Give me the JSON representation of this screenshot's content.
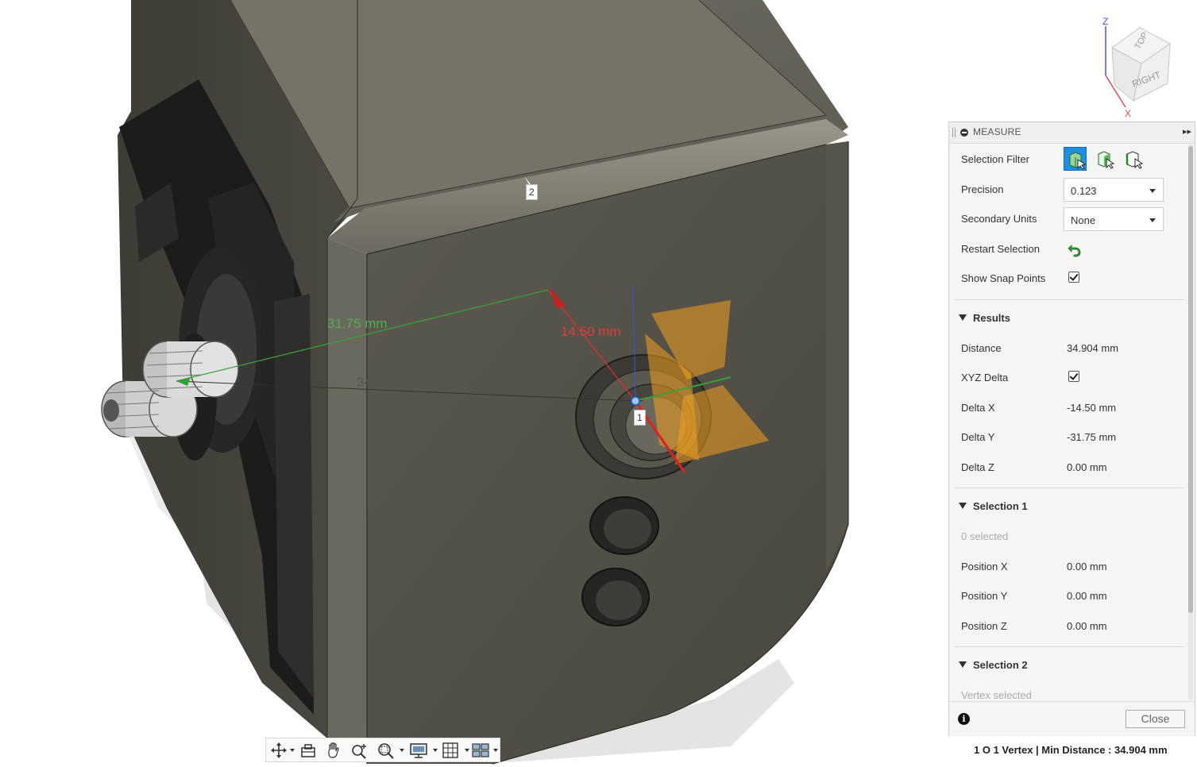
{
  "viewport": {
    "dimensions": [
      {
        "value": "31.75 mm",
        "color": "#4fb04f"
      },
      {
        "value": "14.50 mm",
        "color": "#e33b3b"
      },
      {
        "value": "34.904 mm",
        "color": "#555555"
      }
    ],
    "points": [
      "1",
      "2"
    ]
  },
  "viewcube": {
    "top_label": "TOP",
    "right_label": "RIGHT",
    "z_axis": "Z",
    "x_axis": "X"
  },
  "panel": {
    "title": "MEASURE",
    "selection_filter_label": "Selection Filter",
    "precision_label": "Precision",
    "precision_value": "0.123",
    "secondary_units_label": "Secondary Units",
    "secondary_units_value": "None",
    "restart_selection_label": "Restart Selection",
    "show_snap_points_label": "Show Snap Points",
    "show_snap_points_checked": true,
    "results": {
      "title": "Results",
      "distance_label": "Distance",
      "distance_value": "34.904 mm",
      "xyz_delta_label": "XYZ Delta",
      "xyz_delta_checked": true,
      "delta_x_label": "Delta X",
      "delta_x_value": "-14.50 mm",
      "delta_y_label": "Delta Y",
      "delta_y_value": "-31.75 mm",
      "delta_z_label": "Delta Z",
      "delta_z_value": "0.00 mm"
    },
    "selection1": {
      "title": "Selection 1",
      "status": "0 selected",
      "pos_x_label": "Position X",
      "pos_x_value": "0.00 mm",
      "pos_y_label": "Position Y",
      "pos_y_value": "0.00 mm",
      "pos_z_label": "Position Z",
      "pos_z_value": "0.00 mm"
    },
    "selection2": {
      "title": "Selection 2",
      "status": "Vertex selected"
    },
    "close_label": "Close",
    "info_icon": "i"
  },
  "status_bar": "1 O 1 Vertex | Min Distance : 34.904 mm",
  "colors": {
    "accent": "#1f8fe0",
    "model_face": "#4d4a41",
    "highlight": "#f0a020"
  }
}
